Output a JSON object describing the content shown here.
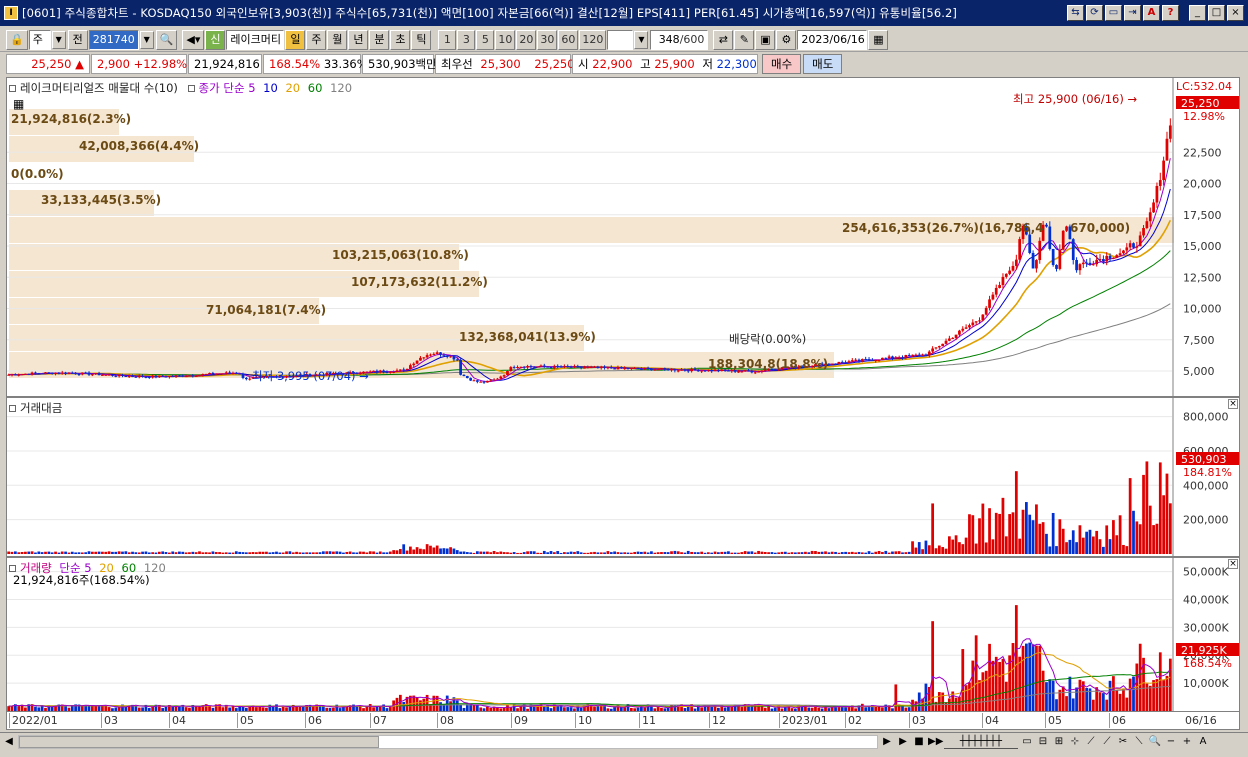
{
  "window": {
    "title": "[0601] 주식종합차트 - KOSDAQ150 외국인보유[3,903(천)] 주식수[65,731(천)] 액면[100] 자본금[66(억)] 결산[12월] EPS[411] PER[61.45] 시가총액[16,597(억)] 유통비율[56.2]",
    "buttons": [
      "⇆",
      "⟳",
      "▭",
      "⇥",
      "A",
      "?",
      "_",
      "□",
      "×"
    ]
  },
  "toolbar": {
    "period_type": "주",
    "prev_label": "전",
    "code": "281740",
    "name": "레이크머티",
    "chart_types": [
      "일",
      "주",
      "월",
      "년",
      "분",
      "초",
      "틱"
    ],
    "active_chart_type": "일",
    "intervals": [
      "1",
      "3",
      "5",
      "10",
      "20",
      "30",
      "60",
      "120"
    ],
    "count": "348",
    "count_max": "/600",
    "date": "2023/06/16"
  },
  "quote": {
    "price": "25,250",
    "arrow": "▲",
    "change": "2,900",
    "change_pct": "+12.98%",
    "volume": "21,924,816",
    "volume_ratio": "168.54%",
    "turnover": "33.36%",
    "amount": "530,903백만",
    "best_ask_label": "최우선",
    "best_ask": "25,300",
    "best_bid": "25,250",
    "open_label": "시",
    "open": "22,900",
    "high_label": "고",
    "high": "25,900",
    "low_label": "저",
    "low": "22,300",
    "buy_label": "매수",
    "sell_label": "매도"
  },
  "price_panel": {
    "title": "레이크머티리얼즈 매물대 수(10)",
    "ma_label": "종가 단순",
    "ma_periods": [
      "5",
      "10",
      "20",
      "60",
      "120"
    ],
    "high_annotation": "최고 25,900 (06/16) →",
    "low_annotation": "최저 3,995 (07/04) →",
    "dividend_annotation": "배당락(0.00%)",
    "lc_label": "LC:532.04",
    "current_price_box": "25,250",
    "current_pct": "12.98%",
    "y_ticks": [
      "22,500",
      "20,000",
      "17,500",
      "15,000",
      "12,500",
      "10,000",
      "7,500",
      "5,000"
    ],
    "volume_profile": [
      "21,924,816(2.3%)",
      "42,008,366(4.4%)",
      "0(0.0%)",
      "33,133,445(3.5%)",
      "254,616,353(26.7%)(16,786,4",
      "670,000)",
      "103,215,063(10.8%)",
      "107,173,632(11.2%)",
      "71,064,181(7.4%)",
      "132,368,041(13.9%)",
      "188,304,8(18.8%)"
    ]
  },
  "amount_panel": {
    "title": "거래대금",
    "current_box": "530,903",
    "current_pct": "184.81%",
    "y_ticks": [
      "800,000",
      "600,000",
      "400,000",
      "200,000"
    ]
  },
  "volume_panel": {
    "title": "거래량",
    "ma_label": "단순",
    "ma_periods": [
      "5",
      "20",
      "60",
      "120"
    ],
    "current_text": "21,924,816주(168.54%)",
    "current_box": "21,925K",
    "current_pct": "168.54%",
    "y_ticks": [
      "50,000K",
      "40,000K",
      "30,000K",
      "20,000K",
      "10,000K"
    ]
  },
  "x_axis": {
    "labels": [
      "2022/01",
      "03",
      "04",
      "05",
      "06",
      "07",
      "08",
      "09",
      "10",
      "11",
      "12",
      "2023/01",
      "02",
      "03",
      "04",
      "05",
      "06"
    ],
    "last_label": "06/16"
  },
  "colors": {
    "up": "#e00000",
    "down": "#0030d0",
    "profile": "#f5e6d2",
    "profile_text": "#6b4a14",
    "ma5": "#9900cc",
    "ma10": "#0000cc",
    "ma20": "#e0a000",
    "ma60": "#008000",
    "ma120": "#808080"
  }
}
